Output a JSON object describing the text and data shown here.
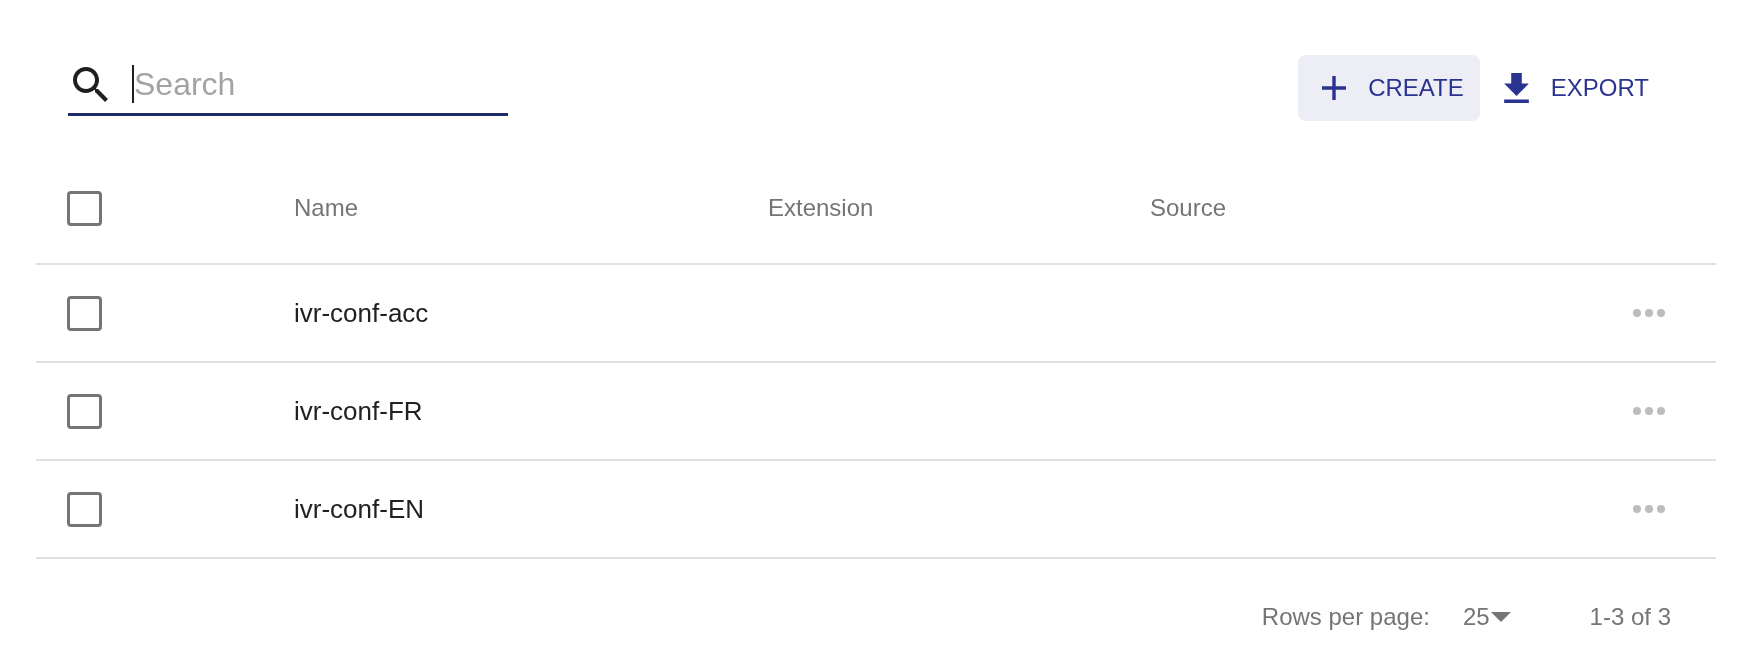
{
  "search": {
    "placeholder": "Search",
    "focused": true
  },
  "toolbar": {
    "buttons": [
      {
        "kind": "create",
        "label": "CREATE",
        "hovered": true
      },
      {
        "kind": "export",
        "label": "EXPORT",
        "hovered": false
      }
    ]
  },
  "table": {
    "select_all": {
      "checked": false
    },
    "columns": [
      "Name",
      "Extension",
      "Source"
    ],
    "rows": [
      {
        "name": "ivr-conf-acc",
        "checked": false
      },
      {
        "name": "ivr-conf-FR",
        "checked": false
      },
      {
        "name": "ivr-conf-EN",
        "checked": false
      }
    ]
  },
  "pagination": {
    "rows_per_page_label": "Rows per page:",
    "rows_per_page": "25",
    "range": "1-3 of 3"
  }
}
